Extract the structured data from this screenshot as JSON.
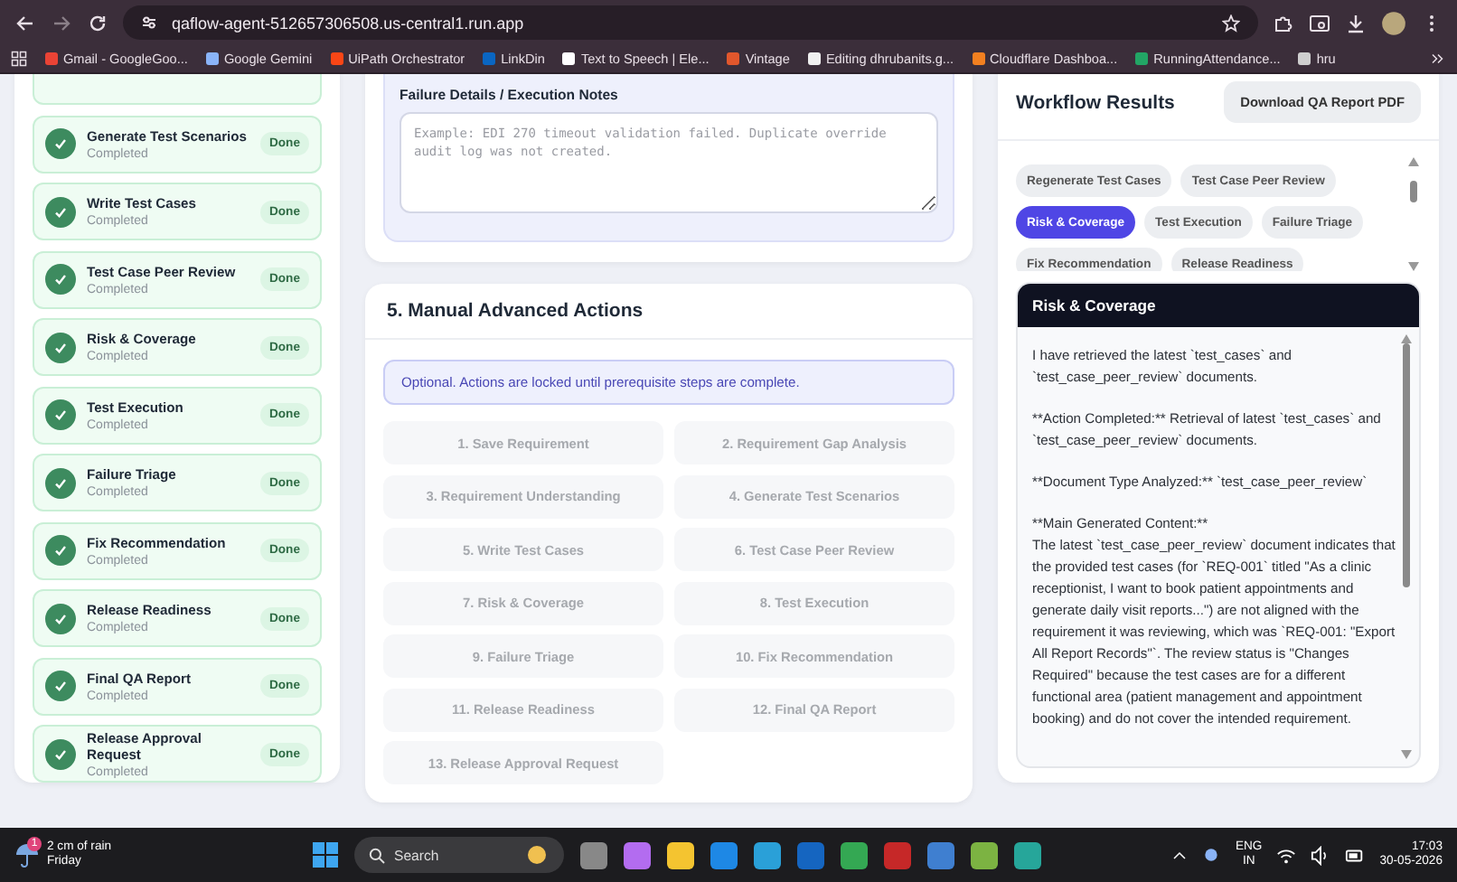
{
  "browser": {
    "url": "qaflow-agent-512657306508.us-central1.run.app",
    "bookmarks": [
      "Gmail - GoogleGoo...",
      "Google Gemini",
      "UiPath Orchestrator",
      "LinkDin",
      "Text to Speech | Ele...",
      "Vintage",
      "Editing dhrubanits.g...",
      "Cloudflare Dashboa...",
      "RunningAttendance...",
      "hru"
    ]
  },
  "steps": [
    {
      "title": "Generate Test Scenarios",
      "status": "Completed",
      "badge": "Done"
    },
    {
      "title": "Write Test Cases",
      "status": "Completed",
      "badge": "Done"
    },
    {
      "title": "Test Case Peer Review",
      "status": "Completed",
      "badge": "Done"
    },
    {
      "title": "Risk & Coverage",
      "status": "Completed",
      "badge": "Done"
    },
    {
      "title": "Test Execution",
      "status": "Completed",
      "badge": "Done"
    },
    {
      "title": "Failure Triage",
      "status": "Completed",
      "badge": "Done"
    },
    {
      "title": "Fix Recommendation",
      "status": "Completed",
      "badge": "Done"
    },
    {
      "title": "Release Readiness",
      "status": "Completed",
      "badge": "Done"
    },
    {
      "title": "Final QA Report",
      "status": "Completed",
      "badge": "Done"
    },
    {
      "title": "Release Approval Request",
      "status": "Completed",
      "badge": "Done"
    }
  ],
  "failure_notes": {
    "label": "Failure Details / Execution Notes",
    "placeholder": "Example: EDI 270 timeout validation failed. Duplicate override audit log was not created."
  },
  "manual_actions": {
    "title": "5. Manual Advanced Actions",
    "notice": "Optional. Actions are locked until prerequisite steps are complete.",
    "actions": [
      {
        "label": "1. Save Requirement",
        "disabled": true
      },
      {
        "label": "2. Requirement Gap Analysis",
        "disabled": true
      },
      {
        "label": "3. Requirement Understanding",
        "disabled": true
      },
      {
        "label": "4. Generate Test Scenarios",
        "disabled": true
      },
      {
        "label": "5. Write Test Cases",
        "disabled": true
      },
      {
        "label": "6. Test Case Peer Review",
        "disabled": true
      },
      {
        "label": "7. Risk & Coverage",
        "disabled": true
      },
      {
        "label": "8. Test Execution",
        "disabled": true
      },
      {
        "label": "9. Failure Triage",
        "disabled": true
      },
      {
        "label": "10. Fix Recommendation",
        "disabled": true
      },
      {
        "label": "11. Release Readiness",
        "disabled": true
      },
      {
        "label": "12. Final QA Report",
        "disabled": true
      },
      {
        "label": "13. Release Approval Request",
        "disabled": true
      }
    ]
  },
  "results": {
    "title": "Workflow Results",
    "download_button": "Download QA Report PDF",
    "tabs": [
      {
        "label": "Regenerate Test Cases",
        "selected": false
      },
      {
        "label": "Test Case Peer Review",
        "selected": false
      },
      {
        "label": "Risk & Coverage",
        "selected": true
      },
      {
        "label": "Test Execution",
        "selected": false
      },
      {
        "label": "Failure Triage",
        "selected": false
      },
      {
        "label": "Fix Recommendation",
        "selected": false
      },
      {
        "label": "Release Readiness",
        "selected": false
      }
    ],
    "panel": {
      "title": "Risk & Coverage",
      "paragraphs": [
        "I have retrieved the latest `test_cases` and `test_case_peer_review` documents.",
        "**Action Completed:** Retrieval of latest `test_cases` and `test_case_peer_review` documents.",
        "**Document Type Analyzed:** `test_case_peer_review`",
        "**Main Generated Content:**\nThe latest `test_case_peer_review` document indicates that the provided test cases (for `REQ-001` titled \"As a clinic receptionist, I want to book patient appointments and generate daily visit reports...\") are not aligned with the requirement it was reviewing, which was `REQ-001: \"Export All Report Records\"`. The review status is \"Changes Required\" because the test cases are for a different functional area (patient management and appointment booking) and do not cover the intended requirement."
      ]
    }
  },
  "taskbar": {
    "weather_badge": "1",
    "weather": "2 cm of rain",
    "day": "Friday",
    "search": "Search",
    "lang": "ENG",
    "region": "IN",
    "time": "17:03",
    "date": "30-05-2026"
  }
}
